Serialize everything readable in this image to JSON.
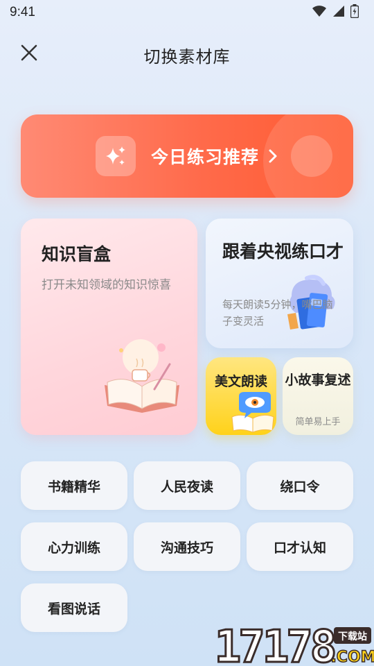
{
  "status": {
    "time": "9:41"
  },
  "header": {
    "title": "切换素材库",
    "close_icon": "close-icon"
  },
  "banner": {
    "label": "今日练习推荐",
    "icon": "sparkle-icon",
    "arrow_icon": "chevron-right-icon"
  },
  "cards": {
    "knowledge": {
      "title": "知识盲盒",
      "subtitle": "打开未知领域的知识惊喜",
      "illustration": "open-book-illustration"
    },
    "cctv": {
      "title": "跟着央视练口才",
      "subtitle": "每天朗读5分钟，嘴巴脑子变灵活",
      "illustration": "stacked-books-illustration"
    },
    "meiwen": {
      "title": "美文朗读",
      "illustration": "speech-bubble-eye-illustration"
    },
    "story": {
      "title": "小故事复述",
      "subtitle": "简单易上手"
    }
  },
  "tags": [
    {
      "label": "书籍精华"
    },
    {
      "label": "人民夜读"
    },
    {
      "label": "绕口令"
    },
    {
      "label": "心力训练"
    },
    {
      "label": "沟通技巧"
    },
    {
      "label": "口才认知"
    },
    {
      "label": "看图说话"
    }
  ],
  "watermark": {
    "brand": "17178",
    "suffix": ".COM",
    "badge": "下载站"
  },
  "colors": {
    "banner_start": "#ff8a74",
    "banner_end": "#ff5a30",
    "accent_yellow": "#ffd21a"
  }
}
